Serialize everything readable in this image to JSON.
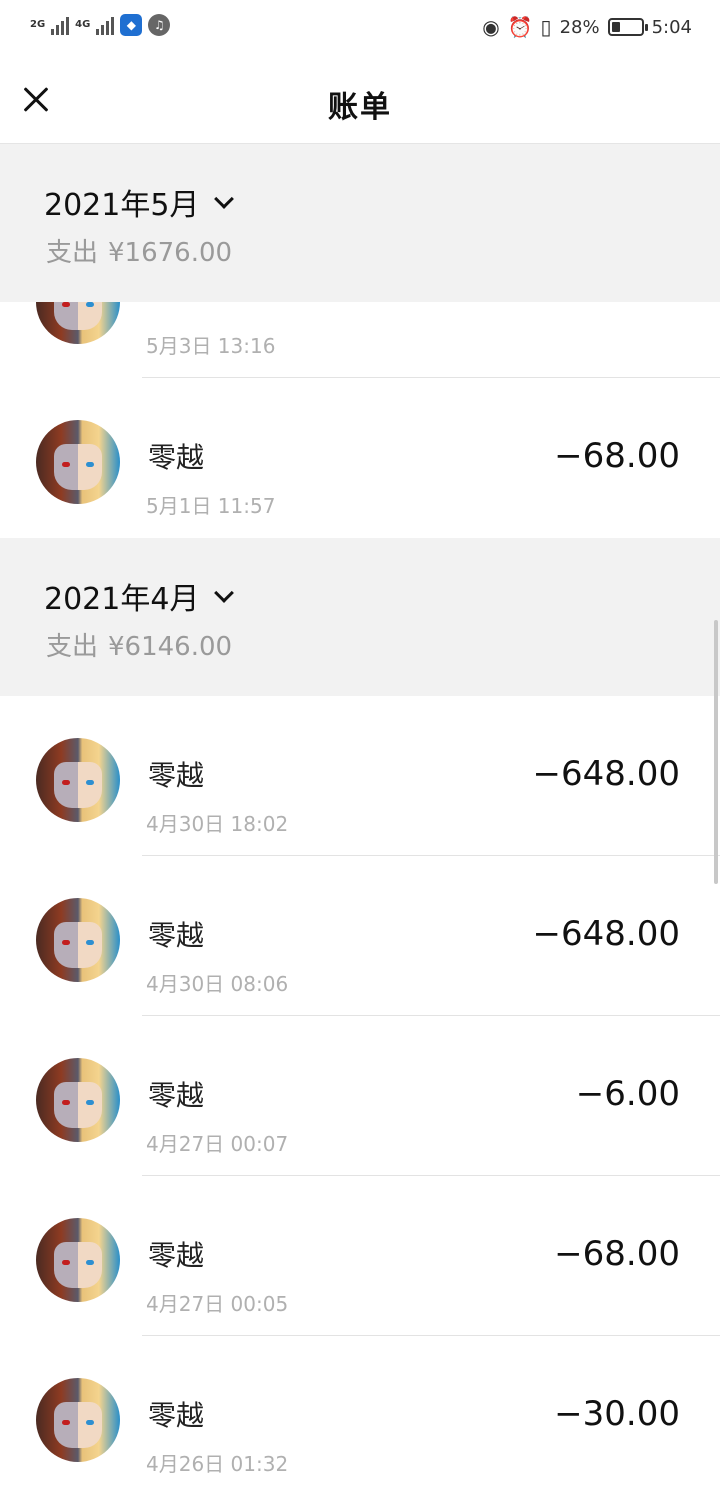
{
  "status_bar": {
    "net1": "2G",
    "net2": "4G",
    "battery_text": "28%",
    "battery_level": 0.28,
    "time": "5:04",
    "icons": [
      "signal-icon",
      "app-shield-icon",
      "app-voice-icon",
      "eye-icon",
      "alarm-icon",
      "vibrate-icon",
      "battery-icon"
    ]
  },
  "header": {
    "title": "账单"
  },
  "groups": [
    {
      "month": "2021年5月",
      "total_label": "支出",
      "total_value": "¥1676.00",
      "rows": [
        {
          "name": "",
          "time": "5月3日 13:16",
          "amount": ""
        },
        {
          "name": "零越",
          "time": "5月1日 11:57",
          "amount": "−68.00"
        }
      ]
    },
    {
      "month": "2021年4月",
      "total_label": "支出",
      "total_value": "¥6146.00",
      "rows": [
        {
          "name": "零越",
          "time": "4月30日 18:02",
          "amount": "−648.00"
        },
        {
          "name": "零越",
          "time": "4月30日 08:06",
          "amount": "−648.00"
        },
        {
          "name": "零越",
          "time": "4月27日 00:07",
          "amount": "−6.00"
        },
        {
          "name": "零越",
          "time": "4月27日 00:05",
          "amount": "−68.00"
        },
        {
          "name": "零越",
          "time": "4月26日 01:32",
          "amount": "−30.00"
        }
      ]
    }
  ]
}
